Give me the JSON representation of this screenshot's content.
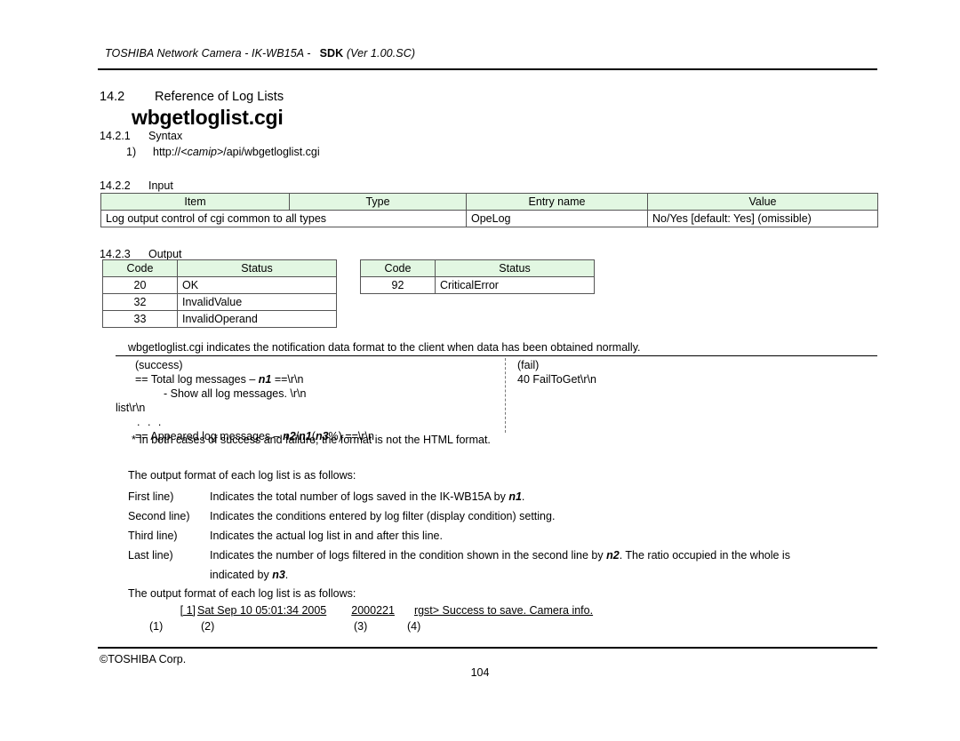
{
  "running_header": {
    "main": "TOSHIBA Network Camera - IK-WB15A -",
    "sdk": "SDK",
    "version": "(Ver 1.00.SC)"
  },
  "section": {
    "number": "14.2",
    "title": "Reference of Log Lists",
    "cgi_name": "wbgetloglist.cgi"
  },
  "syntax": {
    "heading_number": "14.2.1",
    "heading_label": "Syntax",
    "item_index": "1)",
    "url_prefix": "http://",
    "url_var": "<camip>",
    "url_suffix": "/api/wbgetloglist.cgi"
  },
  "input": {
    "heading_number": "14.2.2",
    "heading_label": "Input",
    "columns": [
      "Item",
      "Type",
      "Entry name",
      "Value"
    ],
    "rows": [
      {
        "item": "Log output control of cgi common to all types",
        "type": "",
        "entry_name": "OpeLog",
        "value": "No/Yes [default: Yes] (omissible)"
      }
    ]
  },
  "output": {
    "heading_number": "14.2.3",
    "heading_label": "Output",
    "left_table": {
      "columns": [
        "Code",
        "Status"
      ],
      "rows": [
        {
          "code": "20",
          "status": "OK"
        },
        {
          "code": "32",
          "status": "InvalidValue"
        },
        {
          "code": "33",
          "status": "InvalidOperand"
        }
      ]
    },
    "right_table": {
      "columns": [
        "Code",
        "Status"
      ],
      "rows": [
        {
          "code": "92",
          "status": "CriticalError"
        }
      ]
    }
  },
  "notification": {
    "description": "wbgetloglist.cgi indicates the notification data format to the client when data has been obtained normally.",
    "success": {
      "title": "(success)",
      "line1_pre": "== Total log messages – ",
      "line1_var": "n1",
      "line1_post": " ==\\r\\n",
      "line2": "- Show all log messages. \\r\\n",
      "line3": "list\\r\\n",
      "line4": ". . .",
      "line5_pre": "== Appeared log messages – ",
      "line5_var1": "n2",
      "line5_mid1": "/",
      "line5_var2": "n1",
      "line5_mid2": "(",
      "line5_var3": "n3",
      "line5_mid3": "%)",
      "line5_post": " ==\\r\\n"
    },
    "fail": {
      "title": "(fail)",
      "line1": "40 FailToGet\\r\\n"
    },
    "footnote": "* In both cases of success and failure, the format is not the HTML format."
  },
  "explanation": {
    "intro": "The output format of each log list is as follows:",
    "rows": [
      {
        "label": "First line)",
        "text_pre": "Indicates the total number of logs saved in the IK-WB15A by ",
        "var": "n1",
        "text_post": ".",
        "continuation": ""
      },
      {
        "label": "Second line)",
        "text_pre": "Indicates the conditions entered by log filter (display condition) setting.",
        "var": "",
        "text_post": "",
        "continuation": ""
      },
      {
        "label": "Third line)",
        "text_pre": "Indicates the actual log list in and after this line.",
        "var": "",
        "text_post": "",
        "continuation": ""
      },
      {
        "label": "Last line)",
        "text_pre": "Indicates the number of logs filtered in the condition shown in the second line by ",
        "var": "n2",
        "text_post": ". The ratio occupied in the whole is",
        "continuation_pre": "indicated by ",
        "continuation_var": "n3",
        "continuation_post": "."
      }
    ]
  },
  "sample": {
    "intro": "The output format of each log list is as follows:",
    "segments": [
      "[       1]",
      "Sat Sep   10 05:01:34 2005",
      "2000221",
      "rgst> Success to save. Camera info."
    ],
    "marks": [
      "(1)",
      "(2)",
      "(3)",
      "(4)"
    ]
  },
  "footer": {
    "copyright": "©TOSHIBA Corp.",
    "page_number": "104"
  },
  "colors": {
    "table_header_green": "#e2f7e2",
    "table_border": "#555555",
    "text": "#000000"
  }
}
